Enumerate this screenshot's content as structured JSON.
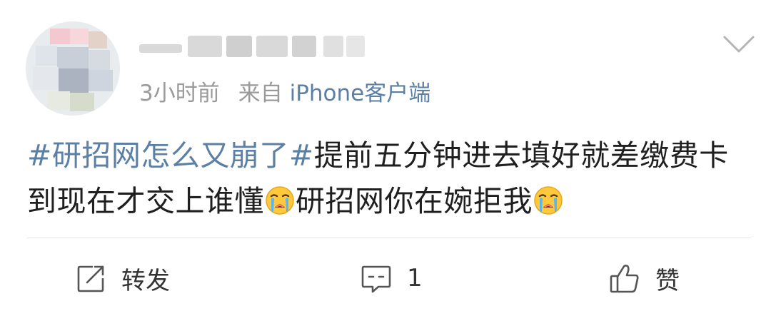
{
  "post": {
    "timestamp": "3小时前",
    "source_prefix": "来自",
    "source_name": "iPhone客户端",
    "content": {
      "topic": "#研招网怎么又崩了#",
      "text_line1": "提前五分钟进去填好就差缴费卡到现在才交上谁懂",
      "text_line2": "研招网你在婉拒我",
      "emoji_name": "crying-emoji"
    }
  },
  "actions": {
    "repost_label": "转发",
    "comment_count": "1",
    "like_label": "赞"
  },
  "colors": {
    "link": "#5b7fa5",
    "meta": "#9a9a9a",
    "text": "#1f1f1f",
    "divider": "#e6e6e6"
  },
  "icons": [
    "chevron-down-icon",
    "repost-icon",
    "comment-icon",
    "like-icon"
  ]
}
